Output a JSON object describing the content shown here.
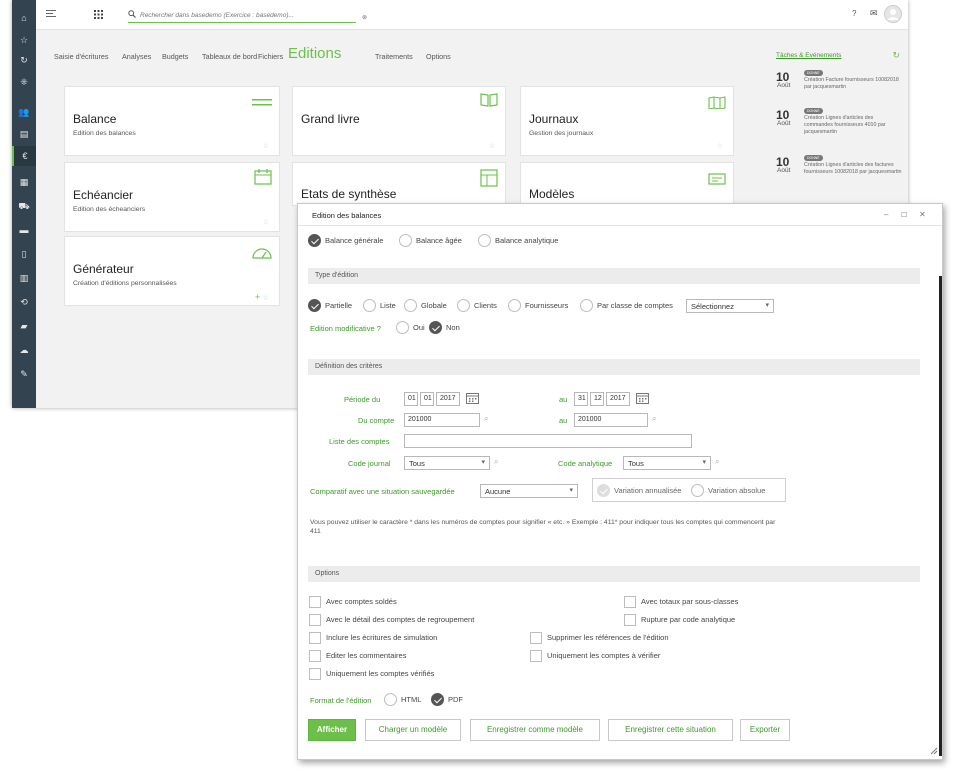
{
  "search": {
    "placeholder": "Rechercher dans basedemo (Exercice : basedemo)..."
  },
  "header": {
    "help": "?",
    "mail": "✉"
  },
  "nav": {
    "items": [
      "Saisie d'écritures",
      "Analyses",
      "Budgets",
      "Tableaux de bord",
      "Fichiers",
      "Editions",
      "Traitements",
      "Options"
    ],
    "active": "Editions"
  },
  "cards": [
    {
      "title": "Balance",
      "desc": "Edition des balances",
      "icon": "lines-icon"
    },
    {
      "title": "Grand livre",
      "desc": "",
      "icon": "book-icon"
    },
    {
      "title": "Journaux",
      "desc": "Gestion des journaux",
      "icon": "map-icon"
    },
    {
      "title": "Echéancier",
      "desc": "Edition des écheanciers",
      "icon": "calendar-icon"
    },
    {
      "title": "Etats de synthèse",
      "desc": "",
      "icon": "layout-icon"
    },
    {
      "title": "Modèles",
      "desc": "",
      "icon": "card-icon"
    },
    {
      "title": "Générateur",
      "desc": "Création d'éditions personnalisées",
      "icon": "gauge-icon"
    }
  ],
  "tasks": {
    "title": "Tâches & Evénements",
    "items": [
      {
        "day": "10",
        "month": "Août",
        "badge": "DONNÉ",
        "text": "Création Facture fournisseurs 10082018 par jacquesmartin"
      },
      {
        "day": "10",
        "month": "Août",
        "badge": "DONNÉ",
        "text": "Création Lignes d'articles des commandes fournisseurs 4010 par jacquesmartin"
      },
      {
        "day": "10",
        "month": "Août",
        "badge": "DONNÉ",
        "text": "Création Lignes d'articles des factures fournisseurs 10082018 par jacquesmartin"
      }
    ]
  },
  "dialog": {
    "title": "Edition des balances",
    "balance_types": [
      {
        "label": "Balance générale",
        "checked": true
      },
      {
        "label": "Balance âgée",
        "checked": false
      },
      {
        "label": "Balance analytique",
        "checked": false
      }
    ],
    "section_type": "Type d'édition",
    "edition_types": [
      {
        "label": "Partielle",
        "checked": true
      },
      {
        "label": "Liste",
        "checked": false
      },
      {
        "label": "Globale",
        "checked": false
      },
      {
        "label": "Clients",
        "checked": false
      },
      {
        "label": "Fournisseurs",
        "checked": false
      },
      {
        "label": "Par classe de comptes",
        "checked": false
      }
    ],
    "classe_select": "Sélectionnez",
    "modifiable_label": "Edition modificative ?",
    "modifiable_options": [
      {
        "label": "Oui",
        "checked": false
      },
      {
        "label": "Non",
        "checked": true
      }
    ],
    "section_criteria": "Définition des critères",
    "periode_label": "Période du",
    "periode_from": {
      "d": "01",
      "m": "01",
      "y": "2017"
    },
    "au_label": "au",
    "periode_to": {
      "d": "31",
      "m": "12",
      "y": "2017"
    },
    "compte_label": "Du compte",
    "compte_from": "201000",
    "compte_to": "201000",
    "liste_label": "Liste des comptes",
    "liste_value": "",
    "journal_label": "Code journal",
    "journal_value": "Tous",
    "analytique_label": "Code analytique",
    "analytique_value": "Tous",
    "comparatif_label": "Comparatif avec une situation sauvegardée",
    "comparatif_value": "Aucune",
    "variation_options": [
      {
        "label": "Variation annualisée",
        "checked": true
      },
      {
        "label": "Variation absolue",
        "checked": false
      }
    ],
    "help_text": "Vous pouvez utiliser le caractère * dans les numéros de comptes pour signifier « etc. » Exemple : 411* pour indiquer tous les comptes qui commencent par 411",
    "section_options": "Options",
    "options_left": [
      "Avec comptes soldés",
      "Avec le détail des comptes de regroupement",
      "Inclure les écritures de simulation",
      "Editer les commentaires",
      "Uniquement les comptes vérifiés"
    ],
    "options_right": [
      "Avec totaux par sous-classes",
      "Rupture par code analytique",
      "Supprimer les références de l'édition",
      "Uniquement les comptes à vérifier"
    ],
    "format_label": "Format de l'édition",
    "format_options": [
      {
        "label": "HTML",
        "checked": false
      },
      {
        "label": "PDF",
        "checked": true
      }
    ],
    "buttons": [
      "Afficher",
      "Charger un modèle",
      "Enregistrer comme modèle",
      "Enregistrer cette situation",
      "Exporter"
    ]
  },
  "colors": {
    "accent": "#6cc04a",
    "sidebar": "#33434f",
    "label_green": "#3d9a2a"
  }
}
